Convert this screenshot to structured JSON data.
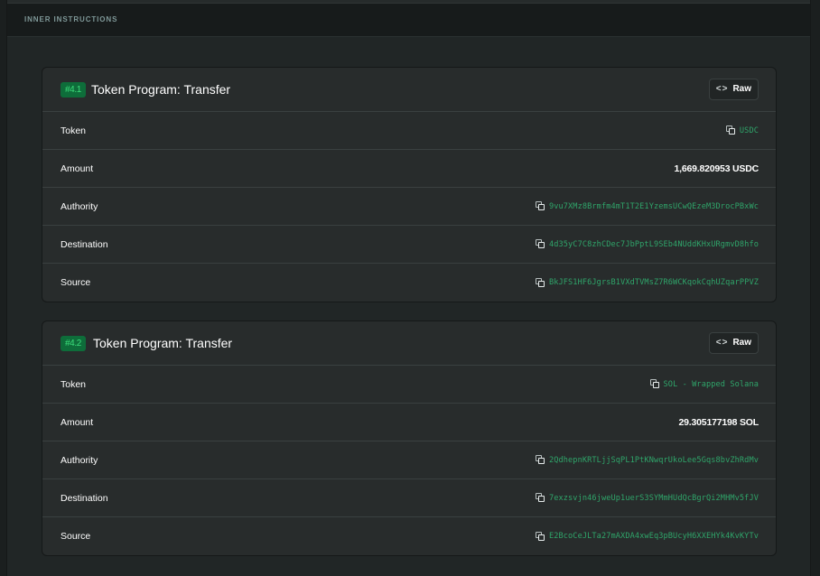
{
  "section": {
    "title": "INNER INSTRUCTIONS"
  },
  "instructions": [
    {
      "badge": "#4.1",
      "title": "Token Program: Transfer",
      "raw_label": "Raw",
      "rows": [
        {
          "label": "Token",
          "value": "USDC",
          "type": "link"
        },
        {
          "label": "Amount",
          "value": "1,669.820953 USDC",
          "type": "text"
        },
        {
          "label": "Authority",
          "value": "9vu7XMz8Brmfm4mT1T2E1YzemsUCwQEzeM3DrocPBxWc",
          "type": "link"
        },
        {
          "label": "Destination",
          "value": "4d35yC7C8zhCDec7JbPptL9SEb4NUddKHxURgmvD8hfo",
          "type": "link"
        },
        {
          "label": "Source",
          "value": "BkJFS1HF6JgrsB1VXdTVMsZ7R6WCKqokCqhUZqarPPVZ",
          "type": "link"
        }
      ]
    },
    {
      "badge": "#4.2",
      "title": "Token Program: Transfer",
      "raw_label": "Raw",
      "rows": [
        {
          "label": "Token",
          "value": "SOL - Wrapped Solana",
          "type": "link"
        },
        {
          "label": "Amount",
          "value": "29.305177198 SOL",
          "type": "text"
        },
        {
          "label": "Authority",
          "value": "2QdhepnKRTLjjSqPL1PtKNwqrUkoLee5Gqs8bvZhRdMv",
          "type": "link"
        },
        {
          "label": "Destination",
          "value": "7exzsvjn46jweUp1uerS3SYMmHUdQcBgrQi2MHMv5fJV",
          "type": "link"
        },
        {
          "label": "Source",
          "value": "E2BcoCeJLTa27mAXDA4xwEq3pBUcyH6XXEHYk4KvKYTv",
          "type": "link"
        }
      ]
    }
  ],
  "colors": {
    "accent_green": "#2fa56a",
    "badge_bg": "#0e6d3a",
    "badge_text": "#3bdc7a"
  },
  "icons": {
    "copy": "copy-icon",
    "code": "code-icon"
  }
}
